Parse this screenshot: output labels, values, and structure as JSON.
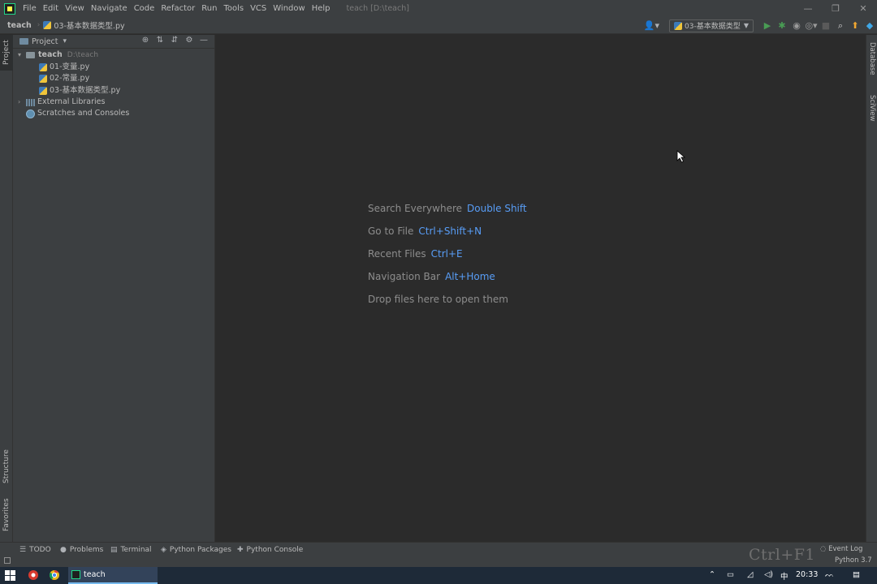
{
  "menu": {
    "items": [
      "File",
      "Edit",
      "View",
      "Navigate",
      "Code",
      "Refactor",
      "Run",
      "Tools",
      "VCS",
      "Window",
      "Help"
    ],
    "window_title": "teach [D:\\teach]"
  },
  "window_controls": {
    "minimize": "—",
    "restore": "❐",
    "close": "✕"
  },
  "navbar": {
    "project": "teach",
    "separator": "›",
    "file": "03-基本数据类型.py",
    "run_config": "03-基本数据类型",
    "user_icon": "person-icon"
  },
  "left_stripe": {
    "project_tab": "Project",
    "structure_tab": "Structure",
    "favorites_tab": "Favorites"
  },
  "right_stripe": {
    "database_tab": "Database",
    "sciview_tab": "SciView"
  },
  "project_panel": {
    "title": "Project",
    "dropdown": "▾",
    "root": {
      "label": "teach",
      "path": "D:\\teach"
    },
    "files": [
      "01-变量.py",
      "02-常量.py",
      "03-基本数据类型.py"
    ],
    "external_libraries": "External Libraries",
    "scratches": "Scratches and Consoles"
  },
  "editor_hints": [
    {
      "label": "Search Everywhere",
      "key": "Double Shift"
    },
    {
      "label": "Go to File",
      "key": "Ctrl+Shift+N"
    },
    {
      "label": "Recent Files",
      "key": "Ctrl+E"
    },
    {
      "label": "Navigation Bar",
      "key": "Alt+Home"
    },
    {
      "label": "Drop files here to open them",
      "key": ""
    }
  ],
  "bottom_tabs": {
    "todo": "TODO",
    "problems": "Problems",
    "terminal": "Terminal",
    "python_packages": "Python Packages",
    "python_console": "Python Console"
  },
  "shortcut_overlay": "Ctrl+F1",
  "status": {
    "event_log": "Event Log",
    "interpreter": "Python 3.7"
  },
  "taskbar": {
    "app_label": "teach",
    "ime": "中",
    "clock": "20:33"
  },
  "colors": {
    "accent_link": "#589df6",
    "run_green": "#499c54",
    "panel_bg": "#3c3f41",
    "editor_bg": "#2b2b2b"
  }
}
